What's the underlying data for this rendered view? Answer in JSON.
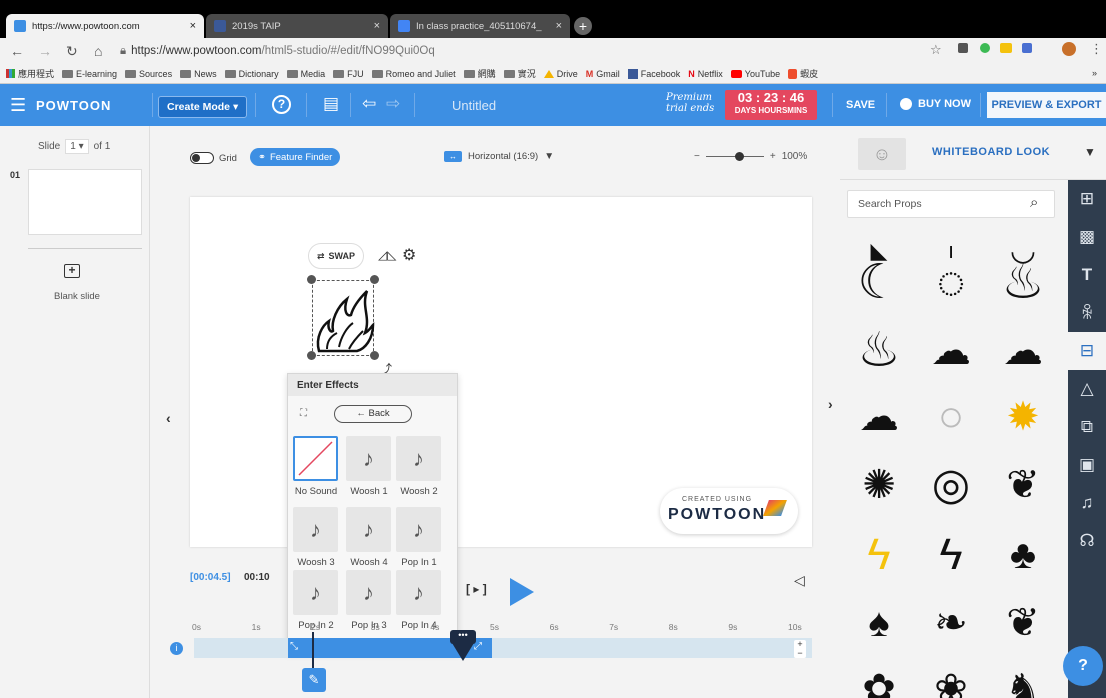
{
  "browser": {
    "tabs": [
      {
        "title": "https://www.powtoon.com",
        "active": true
      },
      {
        "title": "2019s TAIP",
        "active": false
      },
      {
        "title": "In class practice_405110674_",
        "active": false
      }
    ],
    "url_host": "https://www.powtoon.com",
    "url_path": "/html5-studio/#/edit/fNO99Qui0Oq",
    "bookmarks": [
      "應用程式",
      "E-learning",
      "Sources",
      "News",
      "Dictionary",
      "Media",
      "FJU",
      "Romeo and Juliet",
      "網購",
      "實況",
      "Drive",
      "Gmail",
      "Facebook",
      "Netflix",
      "YouTube",
      "蝦皮"
    ],
    "overflow": "»"
  },
  "toolbar": {
    "logo": "POWTOON",
    "mode": "Create Mode",
    "title": "Untitled",
    "premium": "Premium trial ends",
    "timer_value": "03 : 23 : 46",
    "timer_units": "DAYS HOURSMINS",
    "save": "SAVE",
    "buy_now": "BUY NOW",
    "preview": "PREVIEW & EXPORT"
  },
  "slides": {
    "label": "Slide",
    "current": "1",
    "of": "of 1",
    "number": "01",
    "blank_slide": "Blank slide"
  },
  "canvas_bar": {
    "grid": "Grid",
    "feature_finder": "Feature Finder",
    "orientation": "Horizontal (16:9)",
    "zoom": "100%",
    "zoom_minus": "−",
    "zoom_plus": "+"
  },
  "object_toolbar": {
    "swap": "SWAP"
  },
  "watermark": {
    "created": "CREATED USING",
    "brand": "POWTOON"
  },
  "effects": {
    "title": "Enter Effects",
    "back": "← Back",
    "sounds": [
      "No Sound",
      "Woosh 1",
      "Woosh 2",
      "Woosh 3",
      "Woosh 4",
      "Pop In 1",
      "Pop In 2",
      "Pop In 3",
      "Pop In 4"
    ]
  },
  "timeline": {
    "current": "[00:04.5]",
    "total": "00:10",
    "ticks": [
      "0s",
      "1s",
      "2s",
      "3s",
      "4s",
      "5s",
      "6s",
      "7s",
      "8s",
      "9s",
      "10s"
    ],
    "play_bracket": "[ ▸ ]"
  },
  "props_panel": {
    "style": "WHITEBOARD LOOK",
    "search_placeholder": "Search Props"
  },
  "help": "?",
  "colors": {
    "brand": "#3d8fe3",
    "timer": "#e4475f",
    "sidebar": "#2f3d4e"
  }
}
